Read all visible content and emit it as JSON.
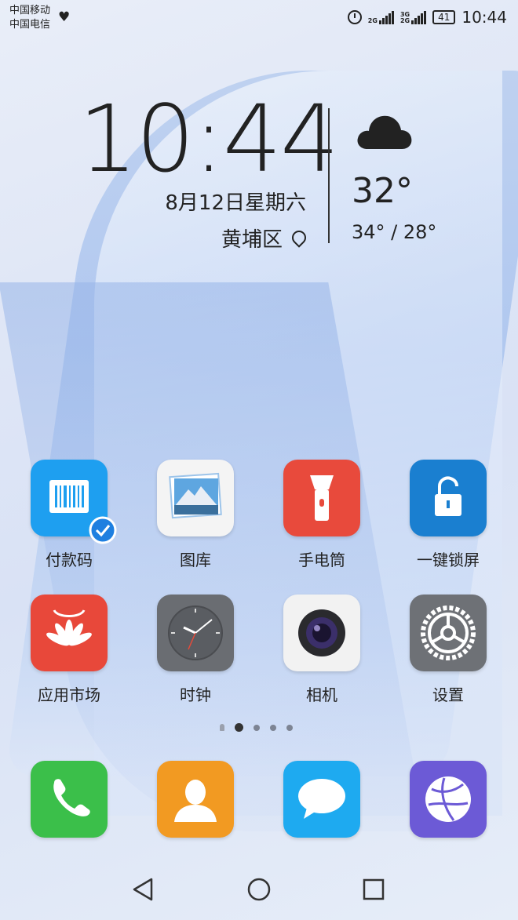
{
  "status_bar": {
    "carrier1": "中国移动",
    "carrier2": "中国电信",
    "network1": "2G",
    "network2a": "3G",
    "network2b": "2G",
    "battery": "41",
    "time": "10:44"
  },
  "clock_widget": {
    "time": "10:44",
    "date": "8月12日星期六",
    "location": "黄埔区"
  },
  "weather_widget": {
    "icon": "cloud-icon",
    "temperature": "32°",
    "range": "34° / 28°"
  },
  "apps": [
    {
      "label": "付款码",
      "icon": "barcode-icon",
      "color": "#1e9ff0"
    },
    {
      "label": "图库",
      "icon": "gallery-icon",
      "color": "#f4f4f4"
    },
    {
      "label": "手电筒",
      "icon": "flashlight-icon",
      "color": "#e84a3c"
    },
    {
      "label": "一键锁屏",
      "icon": "lock-icon",
      "color": "#1a7fd0"
    },
    {
      "label": "应用市场",
      "icon": "appgallery-icon",
      "color": "#e8483a"
    },
    {
      "label": "时钟",
      "icon": "clock-icon",
      "color": "#6a6d72"
    },
    {
      "label": "相机",
      "icon": "camera-icon",
      "color": "#f2f2f2"
    },
    {
      "label": "设置",
      "icon": "settings-icon",
      "color": "#6e7176"
    }
  ],
  "page_indicator": {
    "count": 5,
    "active": 1
  },
  "dock": [
    {
      "icon": "phone-icon",
      "color": "#3bbf4a"
    },
    {
      "icon": "contacts-icon",
      "color": "#f29a22"
    },
    {
      "icon": "messages-icon",
      "color": "#1eaaf0"
    },
    {
      "icon": "browser-icon",
      "color": "#6c5ad6"
    }
  ],
  "nav_bar": [
    "back-icon",
    "home-icon",
    "recents-icon"
  ]
}
